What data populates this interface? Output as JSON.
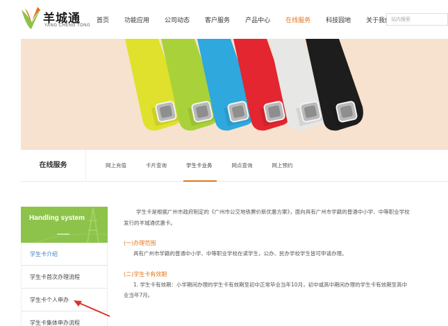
{
  "header": {
    "logo_cn": "羊城通",
    "logo_en": "YANG CHENG TONG",
    "nav": [
      "首页",
      "功能应用",
      "公司动态",
      "客户服务",
      "产品中心",
      "在线服务",
      "科技园地",
      "关于我们"
    ],
    "nav_active": 5,
    "search_placeholder": "站内搜索"
  },
  "banner": {
    "strap_colors": [
      "#dfe12c",
      "#a9d23a",
      "#2ea8dd",
      "#e3262f",
      "#e7e7e5",
      "#1d1d1d"
    ],
    "background": "#f6e2cf"
  },
  "subnav": {
    "title": "在线服务",
    "tabs": [
      "网上充值",
      "卡片查询",
      "学生卡业务",
      "网点查询",
      "网上预约"
    ],
    "active_tab": 2
  },
  "sidebar": {
    "title": "Handling system",
    "items": [
      "学生卡介绍",
      "学生卡首次办理流程",
      "学生卡个人申办",
      "学生卡集体申办流程"
    ],
    "accent": "#8dc34a"
  },
  "content": {
    "intro_1": "学生卡是根据广州市政府制定的《广州市公交地铁票价新优惠方案》，面向具有广州市学籍的普通中小学、中等职业学校",
    "intro_2": "发行的羊城通优惠卡。",
    "section_1_title": "(一)办理范围",
    "section_1_text": "具有广州市学籍的普通中小学、中等职业学校在读学生，公办、民办学校学生皆可申请办理。",
    "section_2_title": "(二)学生卡有效期",
    "section_2_text_1": "1. 学生卡有效期：小学期间办理的学生卡有效期至初中正常毕业当年10月，初中或高中期间办理的学生卡有效期至高中",
    "section_2_text_2": "业当年7月。",
    "accent": "#e0761a"
  }
}
